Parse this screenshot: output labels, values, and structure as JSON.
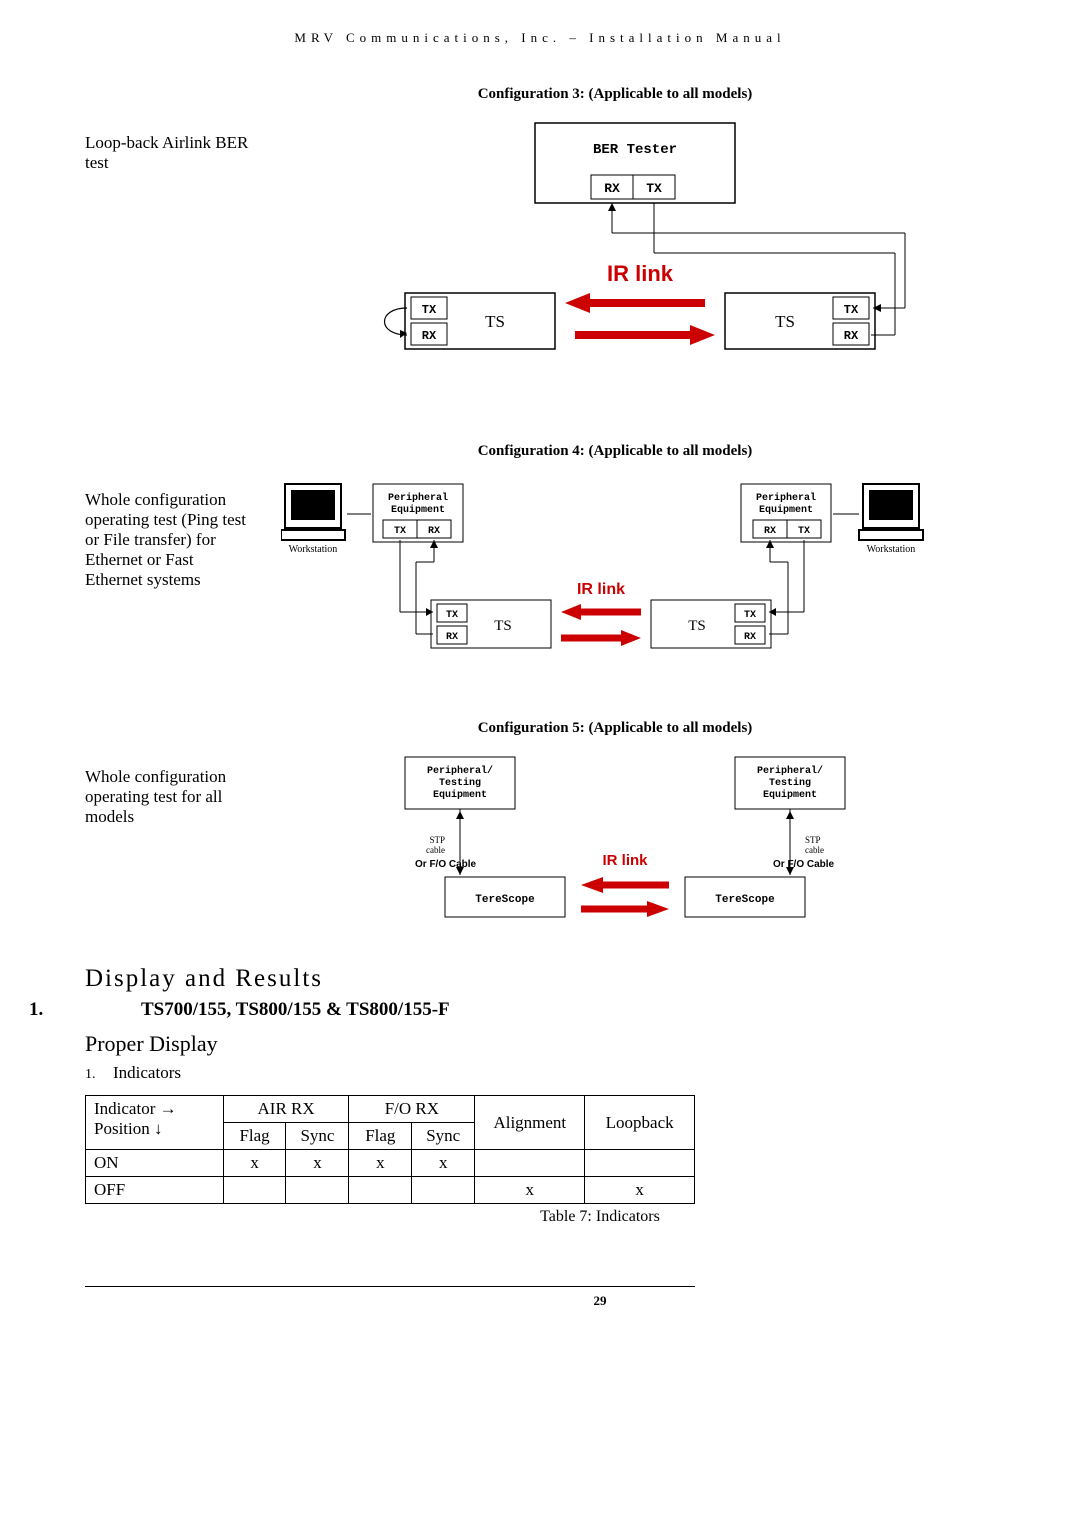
{
  "header": "MRV Communications, Inc. – Installation Manual",
  "config3": {
    "caption": "Configuration 3: (Applicable to all models)",
    "side_label": "Loop-back Airlink BER test",
    "ber_tester": "BER Tester",
    "rx": "RX",
    "tx": "TX",
    "ir_link": "IR link",
    "ts": "TS"
  },
  "config4": {
    "caption": "Configuration 4: (Applicable to all models)",
    "side_label": "Whole configuration operating test (Ping test or File transfer) for Ethernet or Fast Ethernet systems",
    "peripheral": "Peripheral",
    "equipment": "Equipment",
    "workstation": "Workstation",
    "rx": "RX",
    "tx": "TX",
    "ir_link": "IR link",
    "ts": "TS"
  },
  "config5": {
    "caption": "Configuration 5: (Applicable to all models)",
    "side_label": "Whole configuration operating test for all models",
    "peripheral_testing": "Peripheral/",
    "testing": "Testing",
    "equipment": "Equipment",
    "stp": "STP",
    "cable": "cable",
    "or_fo": "Or F/O Cable",
    "ir_link": "IR link",
    "terescope": "TereScope"
  },
  "display_results": "Display and Results",
  "models_heading_num": "1.",
  "models_heading": "TS700/155, TS800/155 & TS800/155-F",
  "proper_display": "Proper Display",
  "indicators_num": "1.",
  "indicators_label": "Indicators",
  "table": {
    "indicator_arrow": "Indicator →",
    "position_arrow": "Position ↓",
    "air_rx": "AIR RX",
    "fo_rx": "F/O RX",
    "alignment": "Alignment",
    "loopback": "Loopback",
    "flag": "Flag",
    "sync": "Sync",
    "on": "ON",
    "off": "OFF",
    "x": "x",
    "caption": "Table 7:  Indicators"
  },
  "page_number": "29",
  "chart_data": [
    {
      "type": "table",
      "title": "Table 7: Indicators",
      "columns": [
        "Indicator →",
        "AIR RX Flag",
        "AIR RX Sync",
        "F/O RX Flag",
        "F/O RX Sync",
        "Alignment",
        "Loopback"
      ],
      "rows": [
        {
          "Position": "ON",
          "AIR RX Flag": "x",
          "AIR RX Sync": "x",
          "F/O RX Flag": "x",
          "F/O RX Sync": "x",
          "Alignment": "",
          "Loopback": ""
        },
        {
          "Position": "OFF",
          "AIR RX Flag": "",
          "AIR RX Sync": "",
          "F/O RX Flag": "",
          "F/O RX Sync": "",
          "Alignment": "x",
          "Loopback": "x"
        }
      ]
    }
  ]
}
